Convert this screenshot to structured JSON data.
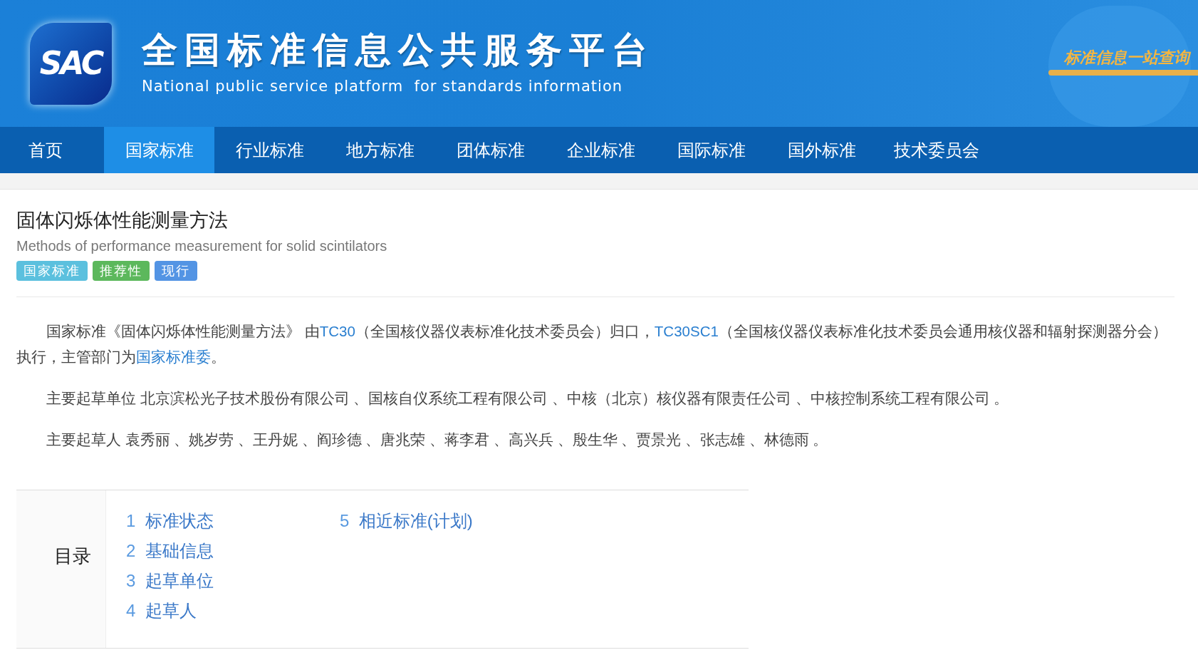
{
  "header": {
    "logo_text": "SAC",
    "title": "全国标准信息公共服务平台",
    "subtitle": "National public service platform  for standards information",
    "slogan": "标准信息一站查询"
  },
  "nav": [
    {
      "label": "首页",
      "selected": false
    },
    {
      "label": "国家标准",
      "selected": true
    },
    {
      "label": "行业标准",
      "selected": false
    },
    {
      "label": "地方标准",
      "selected": false
    },
    {
      "label": "团体标准",
      "selected": false
    },
    {
      "label": "企业标准",
      "selected": false
    },
    {
      "label": "国际标准",
      "selected": false
    },
    {
      "label": "国外标准",
      "selected": false
    },
    {
      "label": "技术委员会",
      "selected": false
    }
  ],
  "standard": {
    "title": "固体闪烁体性能测量方法",
    "title_en": "Methods of performance measurement for solid scintilators",
    "tags": [
      {
        "label": "国家标准",
        "color": "#5bc0de"
      },
      {
        "label": "推荐性",
        "color": "#5cb85c"
      },
      {
        "label": "现行",
        "color": "#5394e4"
      }
    ]
  },
  "paragraphs": [
    [
      {
        "kind": "text",
        "text": "国家标准《固体闪烁体性能测量方法》 由"
      },
      {
        "kind": "link",
        "text": "TC30"
      },
      {
        "kind": "text",
        "text": "（全国核仪器仪表标准化技术委员会）归口，"
      },
      {
        "kind": "link",
        "text": "TC30SC1"
      },
      {
        "kind": "text",
        "text": "（全国核仪器仪表标准化技术委员会通用核仪器和辐射探测器分会）执行，主管部门为"
      },
      {
        "kind": "link",
        "text": "国家标准委"
      },
      {
        "kind": "text",
        "text": "。"
      }
    ],
    [
      {
        "kind": "text",
        "text": "主要起草单位 北京滨松光子技术股份有限公司 、国核自仪系统工程有限公司 、中核（北京）核仪器有限责任公司 、中核控制系统工程有限公司 。"
      }
    ],
    [
      {
        "kind": "text",
        "text": "主要起草人 袁秀丽 、姚岁劳 、王丹妮 、阎珍德 、唐兆荣 、蒋李君 、高兴兵 、殷生华 、贾景光 、张志雄 、林德雨 。"
      }
    ]
  ],
  "toc": {
    "heading": "目录",
    "columns": [
      [
        {
          "number": "1",
          "label": "标准状态"
        },
        {
          "number": "2",
          "label": "基础信息"
        },
        {
          "number": "3",
          "label": "起草单位"
        },
        {
          "number": "4",
          "label": "起草人"
        }
      ],
      [
        {
          "number": "5",
          "label": "相近标准(计划)"
        }
      ]
    ]
  }
}
